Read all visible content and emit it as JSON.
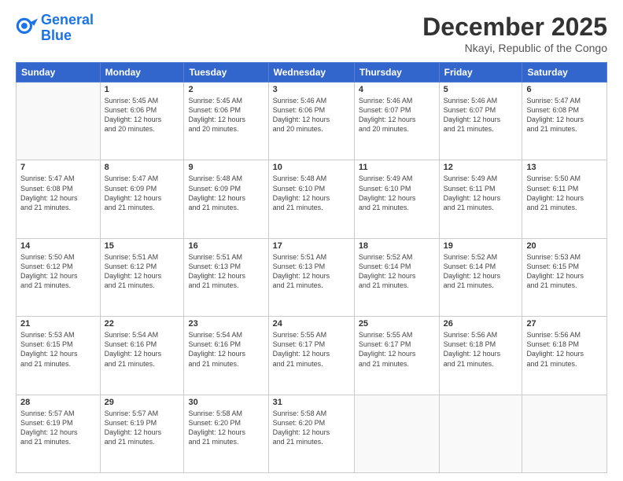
{
  "logo": {
    "line1": "General",
    "line2": "Blue"
  },
  "title": "December 2025",
  "subtitle": "Nkayi, Republic of the Congo",
  "header_days": [
    "Sunday",
    "Monday",
    "Tuesday",
    "Wednesday",
    "Thursday",
    "Friday",
    "Saturday"
  ],
  "weeks": [
    [
      {
        "num": "",
        "info": ""
      },
      {
        "num": "1",
        "info": "Sunrise: 5:45 AM\nSunset: 6:06 PM\nDaylight: 12 hours\nand 20 minutes."
      },
      {
        "num": "2",
        "info": "Sunrise: 5:45 AM\nSunset: 6:06 PM\nDaylight: 12 hours\nand 20 minutes."
      },
      {
        "num": "3",
        "info": "Sunrise: 5:46 AM\nSunset: 6:06 PM\nDaylight: 12 hours\nand 20 minutes."
      },
      {
        "num": "4",
        "info": "Sunrise: 5:46 AM\nSunset: 6:07 PM\nDaylight: 12 hours\nand 20 minutes."
      },
      {
        "num": "5",
        "info": "Sunrise: 5:46 AM\nSunset: 6:07 PM\nDaylight: 12 hours\nand 21 minutes."
      },
      {
        "num": "6",
        "info": "Sunrise: 5:47 AM\nSunset: 6:08 PM\nDaylight: 12 hours\nand 21 minutes."
      }
    ],
    [
      {
        "num": "7",
        "info": "Sunrise: 5:47 AM\nSunset: 6:08 PM\nDaylight: 12 hours\nand 21 minutes."
      },
      {
        "num": "8",
        "info": "Sunrise: 5:47 AM\nSunset: 6:09 PM\nDaylight: 12 hours\nand 21 minutes."
      },
      {
        "num": "9",
        "info": "Sunrise: 5:48 AM\nSunset: 6:09 PM\nDaylight: 12 hours\nand 21 minutes."
      },
      {
        "num": "10",
        "info": "Sunrise: 5:48 AM\nSunset: 6:10 PM\nDaylight: 12 hours\nand 21 minutes."
      },
      {
        "num": "11",
        "info": "Sunrise: 5:49 AM\nSunset: 6:10 PM\nDaylight: 12 hours\nand 21 minutes."
      },
      {
        "num": "12",
        "info": "Sunrise: 5:49 AM\nSunset: 6:11 PM\nDaylight: 12 hours\nand 21 minutes."
      },
      {
        "num": "13",
        "info": "Sunrise: 5:50 AM\nSunset: 6:11 PM\nDaylight: 12 hours\nand 21 minutes."
      }
    ],
    [
      {
        "num": "14",
        "info": "Sunrise: 5:50 AM\nSunset: 6:12 PM\nDaylight: 12 hours\nand 21 minutes."
      },
      {
        "num": "15",
        "info": "Sunrise: 5:51 AM\nSunset: 6:12 PM\nDaylight: 12 hours\nand 21 minutes."
      },
      {
        "num": "16",
        "info": "Sunrise: 5:51 AM\nSunset: 6:13 PM\nDaylight: 12 hours\nand 21 minutes."
      },
      {
        "num": "17",
        "info": "Sunrise: 5:51 AM\nSunset: 6:13 PM\nDaylight: 12 hours\nand 21 minutes."
      },
      {
        "num": "18",
        "info": "Sunrise: 5:52 AM\nSunset: 6:14 PM\nDaylight: 12 hours\nand 21 minutes."
      },
      {
        "num": "19",
        "info": "Sunrise: 5:52 AM\nSunset: 6:14 PM\nDaylight: 12 hours\nand 21 minutes."
      },
      {
        "num": "20",
        "info": "Sunrise: 5:53 AM\nSunset: 6:15 PM\nDaylight: 12 hours\nand 21 minutes."
      }
    ],
    [
      {
        "num": "21",
        "info": "Sunrise: 5:53 AM\nSunset: 6:15 PM\nDaylight: 12 hours\nand 21 minutes."
      },
      {
        "num": "22",
        "info": "Sunrise: 5:54 AM\nSunset: 6:16 PM\nDaylight: 12 hours\nand 21 minutes."
      },
      {
        "num": "23",
        "info": "Sunrise: 5:54 AM\nSunset: 6:16 PM\nDaylight: 12 hours\nand 21 minutes."
      },
      {
        "num": "24",
        "info": "Sunrise: 5:55 AM\nSunset: 6:17 PM\nDaylight: 12 hours\nand 21 minutes."
      },
      {
        "num": "25",
        "info": "Sunrise: 5:55 AM\nSunset: 6:17 PM\nDaylight: 12 hours\nand 21 minutes."
      },
      {
        "num": "26",
        "info": "Sunrise: 5:56 AM\nSunset: 6:18 PM\nDaylight: 12 hours\nand 21 minutes."
      },
      {
        "num": "27",
        "info": "Sunrise: 5:56 AM\nSunset: 6:18 PM\nDaylight: 12 hours\nand 21 minutes."
      }
    ],
    [
      {
        "num": "28",
        "info": "Sunrise: 5:57 AM\nSunset: 6:19 PM\nDaylight: 12 hours\nand 21 minutes."
      },
      {
        "num": "29",
        "info": "Sunrise: 5:57 AM\nSunset: 6:19 PM\nDaylight: 12 hours\nand 21 minutes."
      },
      {
        "num": "30",
        "info": "Sunrise: 5:58 AM\nSunset: 6:20 PM\nDaylight: 12 hours\nand 21 minutes."
      },
      {
        "num": "31",
        "info": "Sunrise: 5:58 AM\nSunset: 6:20 PM\nDaylight: 12 hours\nand 21 minutes."
      },
      {
        "num": "",
        "info": ""
      },
      {
        "num": "",
        "info": ""
      },
      {
        "num": "",
        "info": ""
      }
    ]
  ]
}
